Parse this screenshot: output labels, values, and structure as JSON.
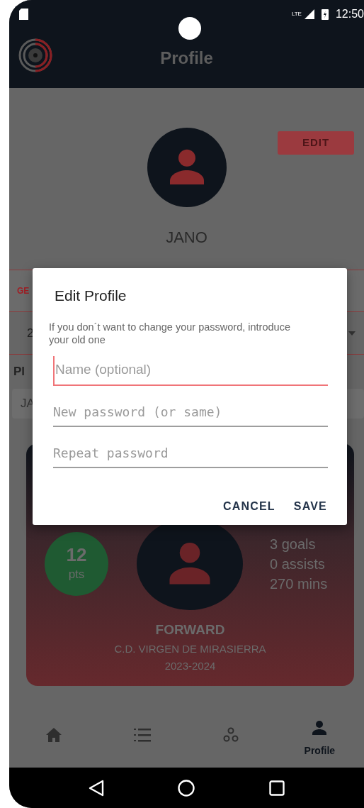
{
  "status_bar": {
    "network": "LTE",
    "time": "12:50"
  },
  "app_bar": {
    "title": "Profile"
  },
  "profile": {
    "edit_button": "EDIT",
    "name": "JANO"
  },
  "background_fragments": {
    "tab": "GE",
    "season": "2",
    "label": "Pl",
    "input": "JA"
  },
  "player_card": {
    "points": "12",
    "points_unit": "pts",
    "stats": [
      "3 goals",
      "0 assists",
      "270 mins"
    ],
    "position": "FORWARD",
    "club": "C.D. VIRGEN DE MIRASIERRA",
    "season": "2023-2024"
  },
  "bottom_nav": [
    {
      "kind": "home",
      "selected": false
    },
    {
      "kind": "ranking",
      "selected": false
    },
    {
      "kind": "teams",
      "selected": false
    },
    {
      "kind": "profile",
      "label": "Profile",
      "selected": true
    }
  ],
  "dialog": {
    "title": "Edit Profile",
    "message": "If you don´t want to change your password, introduce your old one",
    "fields": [
      {
        "kind": "text",
        "placeholder": "Name (optional)",
        "focused": true
      },
      {
        "kind": "password",
        "placeholder": "New password (or same)",
        "focused": false
      },
      {
        "kind": "password",
        "placeholder": "Repeat password",
        "focused": false
      }
    ],
    "buttons": [
      "CANCEL",
      "SAVE"
    ]
  }
}
